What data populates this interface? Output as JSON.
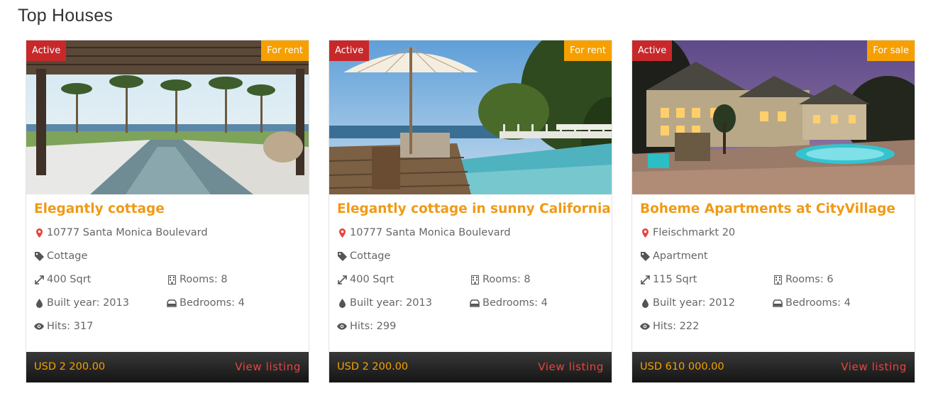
{
  "section": {
    "title": "Top Houses"
  },
  "icons": {
    "location": "map-marker-icon",
    "category": "tag-icon",
    "area": "expand-arrows-icon",
    "rooms": "building-icon",
    "year": "drop-icon",
    "bedrooms": "bed-icon",
    "hits": "eye-icon"
  },
  "colors": {
    "accent": "#f09a15",
    "status_badge": "#c8282a",
    "type_badge": "#f5a000",
    "link": "#e8453c",
    "footer": "#222222"
  },
  "listings": [
    {
      "status": "Active",
      "type": "For rent",
      "title": "Elegantly cottage",
      "address": "10777 Santa Monica Boulevard",
      "category": "Cottage",
      "area": "400 Sqrt",
      "rooms": "Rooms: 8",
      "built_year": "Built year: 2013",
      "bedrooms": "Bedrooms: 4",
      "hits": "Hits: 317",
      "price": "USD 2 200.00",
      "view_label": "View listing"
    },
    {
      "status": "Active",
      "type": "For rent",
      "title": "Elegantly cottage in sunny California",
      "address": "10777 Santa Monica Boulevard",
      "category": "Cottage",
      "area": "400 Sqrt",
      "rooms": "Rooms: 8",
      "built_year": "Built year: 2013",
      "bedrooms": "Bedrooms: 4",
      "hits": "Hits: 299",
      "price": "USD 2 200.00",
      "view_label": "View listing"
    },
    {
      "status": "Active",
      "type": "For sale",
      "title": "Boheme Apartments at CityVillage",
      "address": "Fleischmarkt 20",
      "category": "Apartment",
      "area": "115 Sqrt",
      "rooms": "Rooms: 6",
      "built_year": "Built year: 2012",
      "bedrooms": "Bedrooms: 4",
      "hits": "Hits: 222",
      "price": "USD 610 000.00",
      "view_label": "View listing"
    }
  ]
}
